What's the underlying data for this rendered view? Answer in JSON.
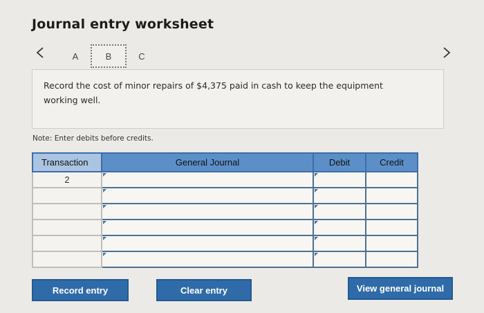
{
  "worksheet": {
    "title": "Journal entry worksheet",
    "tabs": [
      "A",
      "B",
      "C"
    ],
    "prev_icon": "chevron-left-icon",
    "next_icon": "chevron-right-icon",
    "prompt": "Record the cost of minor repairs of $4,375 paid in cash to keep the equipment working well.",
    "note": "Note: Enter debits before credits."
  },
  "table": {
    "headers": {
      "transaction": "Transaction",
      "general_journal": "General Journal",
      "debit": "Debit",
      "credit": "Credit"
    },
    "rows": [
      {
        "transaction": "2",
        "account": "",
        "debit": "",
        "credit": ""
      },
      {
        "transaction": "",
        "account": "",
        "debit": "",
        "credit": ""
      },
      {
        "transaction": "",
        "account": "",
        "debit": "",
        "credit": ""
      },
      {
        "transaction": "",
        "account": "",
        "debit": "",
        "credit": ""
      },
      {
        "transaction": "",
        "account": "",
        "debit": "",
        "credit": ""
      },
      {
        "transaction": "",
        "account": "",
        "debit": "",
        "credit": ""
      }
    ]
  },
  "buttons": {
    "record": "Record entry",
    "clear": "Clear entry",
    "view": "View general journal"
  },
  "colors": {
    "header_blue": "#5c8fc8",
    "header_light": "#aac4e2",
    "button_blue": "#2f6ba8"
  }
}
